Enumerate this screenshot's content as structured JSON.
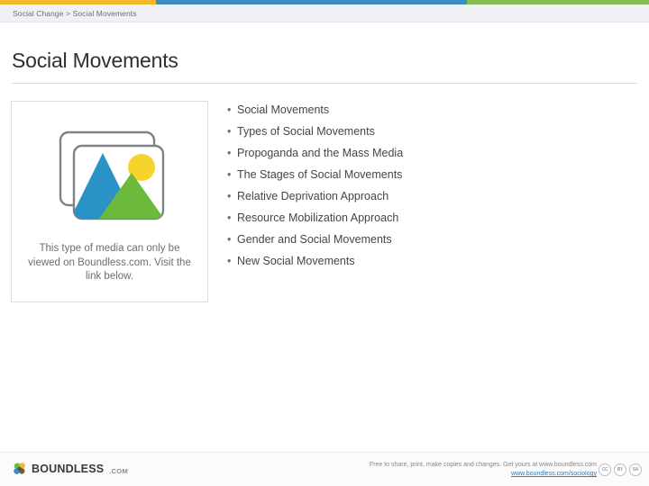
{
  "topbar": {
    "segments": [
      {
        "name": "orange",
        "color": "#f3b828"
      },
      {
        "name": "blue",
        "color": "#3d8ec0"
      },
      {
        "name": "green",
        "color": "#88bd54"
      }
    ]
  },
  "breadcrumb": {
    "text": "Social Change > Social Movements",
    "parent": "Social Change",
    "separator": ">",
    "current": "Social Movements"
  },
  "page": {
    "title": "Social Movements"
  },
  "media_placeholder": {
    "icon": "image-placeholder-icon",
    "note": "This type of media can only be viewed on Boundless.com. Visit the link below.",
    "colors": {
      "mountain_blue": "#2b92c6",
      "mountain_green": "#6cba3c",
      "sun_yellow": "#f6d32d",
      "frame_outline": "#808285"
    }
  },
  "outline": {
    "bullet": "•",
    "items": [
      {
        "label": "Social Movements"
      },
      {
        "label": "Types of Social Movements"
      },
      {
        "label": "Propoganda and the Mass Media"
      },
      {
        "label": "The Stages of Social Movements"
      },
      {
        "label": "Relative Deprivation Approach"
      },
      {
        "label": "Resource Mobilization Approach"
      },
      {
        "label": "Gender and Social Movements"
      },
      {
        "label": "New Social Movements"
      }
    ]
  },
  "footer": {
    "logo_word": "BOUNDLESS",
    "logo_tld": ".COM",
    "legal_line": "Free to share, print, make copies and changes. Get yours at www.boundless.com",
    "link_text": "www.boundless.com/sociology",
    "link_color": "#2f7bb5",
    "cc_badges": [
      {
        "name": "cc",
        "label": "CC"
      },
      {
        "name": "by",
        "label": "BY"
      },
      {
        "name": "sa",
        "label": "SA"
      }
    ]
  }
}
